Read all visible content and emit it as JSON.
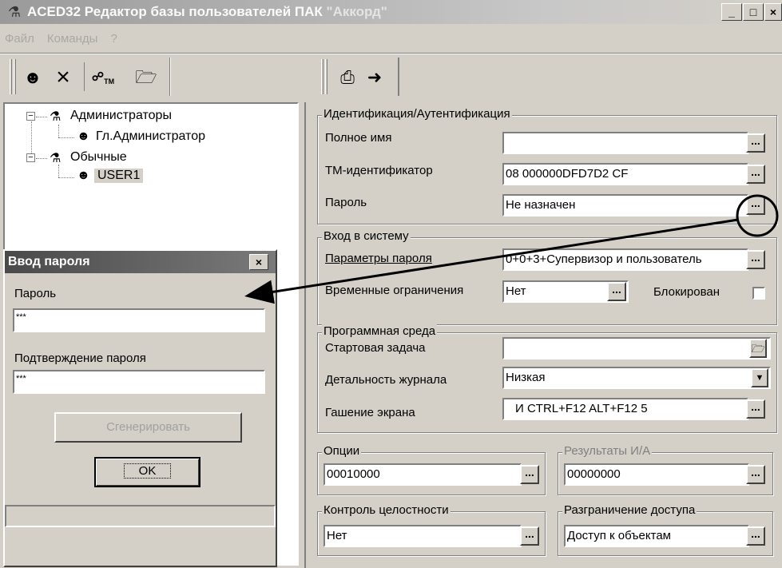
{
  "window": {
    "title_app": "ACED32 Редактор базы пользователей ПАК ",
    "title_quoted": "\"Аккорд\"",
    "icons": {
      "app": "users-app-icon",
      "minimize": "minimize-icon",
      "maximize": "maximize-icon",
      "close": "close-icon"
    }
  },
  "menu": {
    "file": "Файл",
    "commands": "Команды",
    "help": "?"
  },
  "toolbar": {
    "icons": [
      "add-user-icon",
      "delete-icon",
      "tm-key-icon",
      "open-icon",
      "print-icon",
      "exit-icon"
    ]
  },
  "tree": {
    "groups": [
      {
        "label": "Администраторы",
        "users": [
          "Гл.Администратор"
        ]
      },
      {
        "label": "Обычные",
        "users": [
          "USER1"
        ]
      }
    ]
  },
  "password_dialog": {
    "title": "Ввод пароля",
    "password_label": "Пароль",
    "password_value": "***",
    "confirm_label": "Подтверждение пароля",
    "confirm_value": "***",
    "generate_button": "Сгенерировать",
    "ok_button": "OK"
  },
  "identification": {
    "group_title": "Идентификация/Аутентификация",
    "full_name_label": "Полное имя",
    "full_name_value": "",
    "tm_label": "ТМ-идентификатор",
    "tm_value": "08 000000DFD7D2 CF",
    "password_label": "Пароль",
    "password_value": "Не назначен"
  },
  "login": {
    "group_title": "Вход в систему",
    "password_params_label": "Параметры пароля",
    "password_params_value": "0+0+3+Супервизор и пользователь",
    "time_limits_label": "Временные ограничения",
    "time_limits_value": "Нет",
    "blocked_label": "Блокирован"
  },
  "environment": {
    "group_title": "Программная среда",
    "start_task_label": "Стартовая задача",
    "start_task_value": "",
    "log_detail_label": "Детальность журнала",
    "log_detail_value": "Низкая",
    "screen_blank_label": "Гашение экрана",
    "screen_blank_value": "И CTRL+F12 ALT+F12 5"
  },
  "options": {
    "group_title": "Опции",
    "value": "00010000"
  },
  "ia_results": {
    "group_title": "Результаты И/А",
    "value": "00000000"
  },
  "integrity": {
    "group_title": "Контроль целостности",
    "value": "Нет"
  },
  "access": {
    "group_title": "Разграничение доступа",
    "value": "Доступ к объектам"
  },
  "buttons": {
    "ellipsis": "...",
    "dropdown": "▼",
    "folder": "📂"
  }
}
